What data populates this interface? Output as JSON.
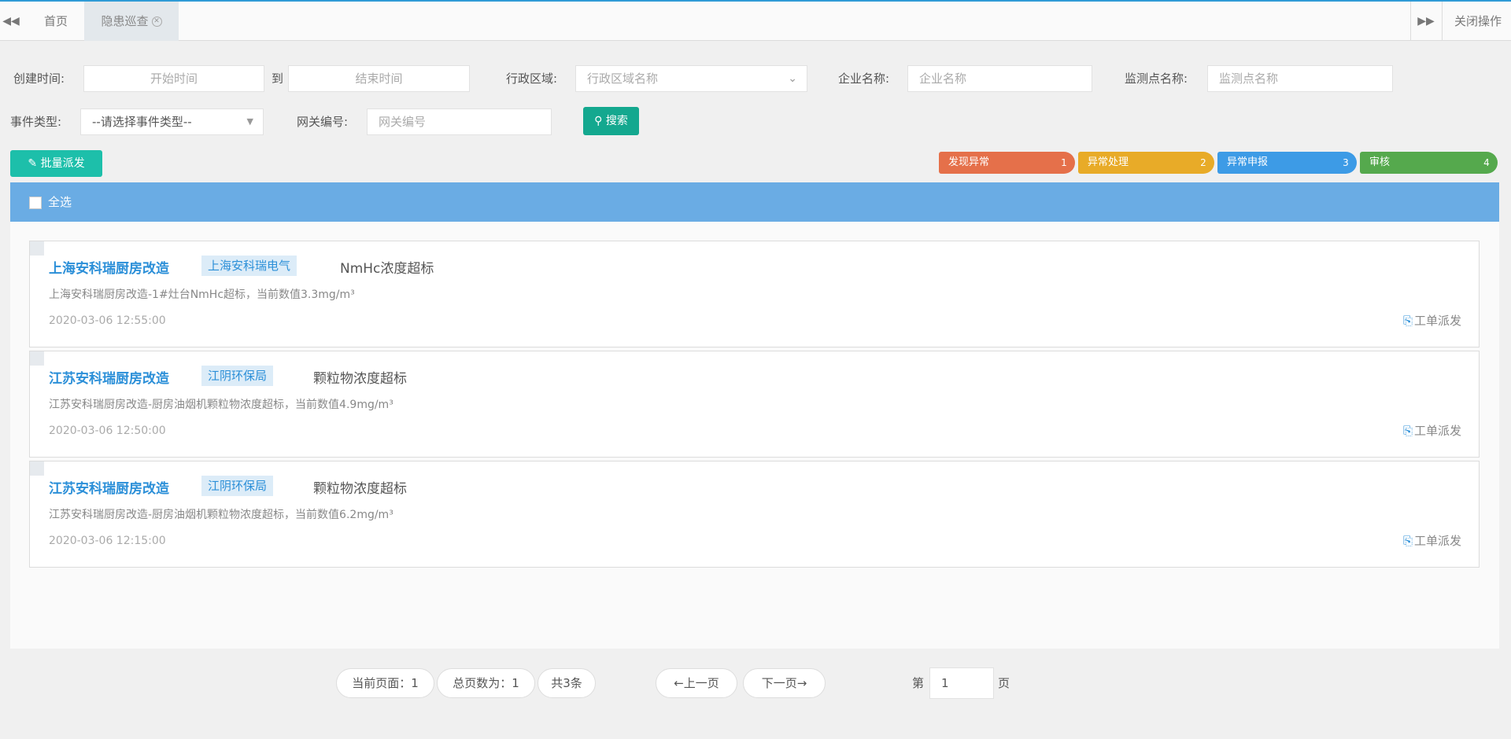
{
  "tabs": {
    "home": "首页",
    "current": "隐患巡查",
    "close_ops": "关闭操作"
  },
  "filters": {
    "created_label": "创建时间:",
    "start_placeholder": "开始时间",
    "to_label": "到",
    "end_placeholder": "结束时间",
    "region_label": "行政区域:",
    "region_placeholder": "行政区域名称",
    "company_label": "企业名称:",
    "company_placeholder": "企业名称",
    "monitor_label": "监测点名称:",
    "monitor_placeholder": "监测点名称",
    "event_type_label": "事件类型:",
    "event_type_value": "--请选择事件类型--",
    "gateway_label": "网关编号:",
    "gateway_placeholder": "网关编号",
    "search_button": "搜索"
  },
  "toolbar": {
    "batch_dispatch": "批量派发"
  },
  "steps": [
    {
      "label": "发现异常",
      "num": "1",
      "color": "#e5704a"
    },
    {
      "label": "异常处理",
      "num": "2",
      "color": "#e8ab28"
    },
    {
      "label": "异常申报",
      "num": "3",
      "color": "#3d9be6"
    },
    {
      "label": "审核",
      "num": "4",
      "color": "#55a94d"
    }
  ],
  "list_header": {
    "select_all": "全选"
  },
  "records": [
    {
      "company": "上海安科瑞厨房改造",
      "agency": "上海安科瑞电气",
      "event": "NmHc浓度超标",
      "description": "上海安科瑞厨房改造-1#灶台NmHc超标，当前数值3.3mg/m³",
      "time": "2020-03-06 12:55:00",
      "action": "工单派发"
    },
    {
      "company": "江苏安科瑞厨房改造",
      "agency": "江阴环保局",
      "event": "颗粒物浓度超标",
      "description": "江苏安科瑞厨房改造-厨房油烟机颗粒物浓度超标，当前数值4.9mg/m³",
      "time": "2020-03-06 12:50:00",
      "action": "工单派发"
    },
    {
      "company": "江苏安科瑞厨房改造",
      "agency": "江阴环保局",
      "event": "颗粒物浓度超标",
      "description": "江苏安科瑞厨房改造-厨房油烟机颗粒物浓度超标，当前数值6.2mg/m³",
      "time": "2020-03-06 12:15:00",
      "action": "工单派发"
    }
  ],
  "pagination": {
    "current_page": "当前页面：1",
    "total_pages": "总页数为：1",
    "total_count": "共3条",
    "prev": "←上一页",
    "next": "下一页→",
    "goto_prefix": "第",
    "goto_value": "1",
    "goto_suffix": "页"
  }
}
